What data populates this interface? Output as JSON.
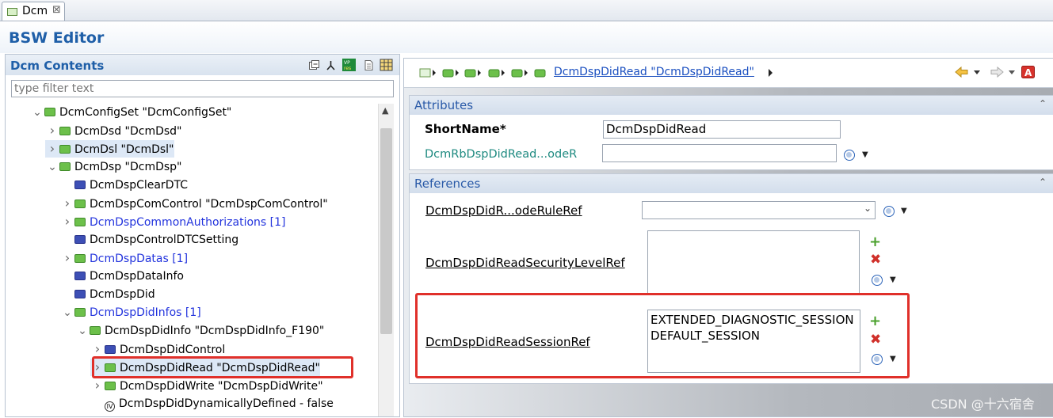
{
  "tab": {
    "label": "Dcm",
    "close_glyph": "⊠"
  },
  "editor": {
    "title": "BSW Editor"
  },
  "left_panel": {
    "title": "Dcm Contents",
    "filter_placeholder": "type filter text",
    "tree": [
      {
        "label": "DcmConfigSet \"DcmConfigSet\"",
        "indent": 0,
        "chevron": "open",
        "icon": "green-folder",
        "blue": false
      },
      {
        "label": "DcmDsd \"DcmDsd\"",
        "indent": 1,
        "chevron": "closed",
        "icon": "green-folder",
        "blue": false
      },
      {
        "label": "DcmDsl \"DcmDsl\"",
        "indent": 1,
        "chevron": "closed",
        "icon": "green-folder",
        "blue": false,
        "shaded": true
      },
      {
        "label": "DcmDsp \"DcmDsp\"",
        "indent": 1,
        "chevron": "open",
        "icon": "green-folder",
        "blue": false
      },
      {
        "label": "DcmDspClearDTC",
        "indent": 2,
        "chevron": "none",
        "icon": "blue-folder",
        "blue": false
      },
      {
        "label": "DcmDspComControl \"DcmDspComControl\"",
        "indent": 2,
        "chevron": "closed",
        "icon": "green-folder",
        "blue": false
      },
      {
        "label": "DcmDspCommonAuthorizations [1]",
        "indent": 2,
        "chevron": "closed",
        "icon": "green-folder",
        "blue": true
      },
      {
        "label": "DcmDspControlDTCSetting",
        "indent": 2,
        "chevron": "none",
        "icon": "blue-folder",
        "blue": false
      },
      {
        "label": "DcmDspDatas [1]",
        "indent": 2,
        "chevron": "closed",
        "icon": "green-folder",
        "blue": true
      },
      {
        "label": "DcmDspDataInfo",
        "indent": 2,
        "chevron": "none",
        "icon": "blue-folder",
        "blue": false
      },
      {
        "label": "DcmDspDid",
        "indent": 2,
        "chevron": "none",
        "icon": "blue-folder",
        "blue": false
      },
      {
        "label": "DcmDspDidInfos [1]",
        "indent": 2,
        "chevron": "open",
        "icon": "green-folder",
        "blue": true
      },
      {
        "label": "DcmDspDidInfo \"DcmDspDidInfo_F190\"",
        "indent": 3,
        "chevron": "open",
        "icon": "green-folder",
        "blue": false
      },
      {
        "label": "DcmDspDidControl",
        "indent": 4,
        "chevron": "closed",
        "icon": "blue-folder",
        "blue": false
      },
      {
        "label": "DcmDspDidRead \"DcmDspDidRead\"",
        "indent": 4,
        "chevron": "closed",
        "icon": "green-folder",
        "blue": false,
        "selected": true
      },
      {
        "label": "DcmDspDidWrite \"DcmDspDidWrite\"",
        "indent": 4,
        "chevron": "closed",
        "icon": "green-folder",
        "blue": false
      },
      {
        "label": "DcmDspDidDynamicallyDefined - false",
        "indent": 4,
        "chevron": "none",
        "icon": "info-param",
        "blue": false
      }
    ]
  },
  "breadcrumb": {
    "current": "DcmDspDidRead \"DcmDspDidRead\""
  },
  "attributes": {
    "title": "Attributes",
    "collapse_glyph": "⌃",
    "shortname_label": "ShortName*",
    "shortname_value": "DcmDspDidRead",
    "rb_label": "DcmRbDspDidRead...odeR",
    "rb_value": ""
  },
  "references": {
    "title": "References",
    "collapse_glyph": "⌃",
    "rule_ref_label": "DcmDspDidR...odeRuleRef",
    "security_ref_label": "DcmDspDidReadSecurityLevelRef",
    "session_ref_label": "DcmDspDidReadSessionRef",
    "session_values": [
      "EXTENDED_DIAGNOSTIC_SESSION",
      "DEFAULT_SESSION"
    ]
  },
  "colors": {
    "highlight": "#e0302a",
    "title_blue": "#1f5fa8"
  },
  "watermark": "CSDN @十六宿舍"
}
